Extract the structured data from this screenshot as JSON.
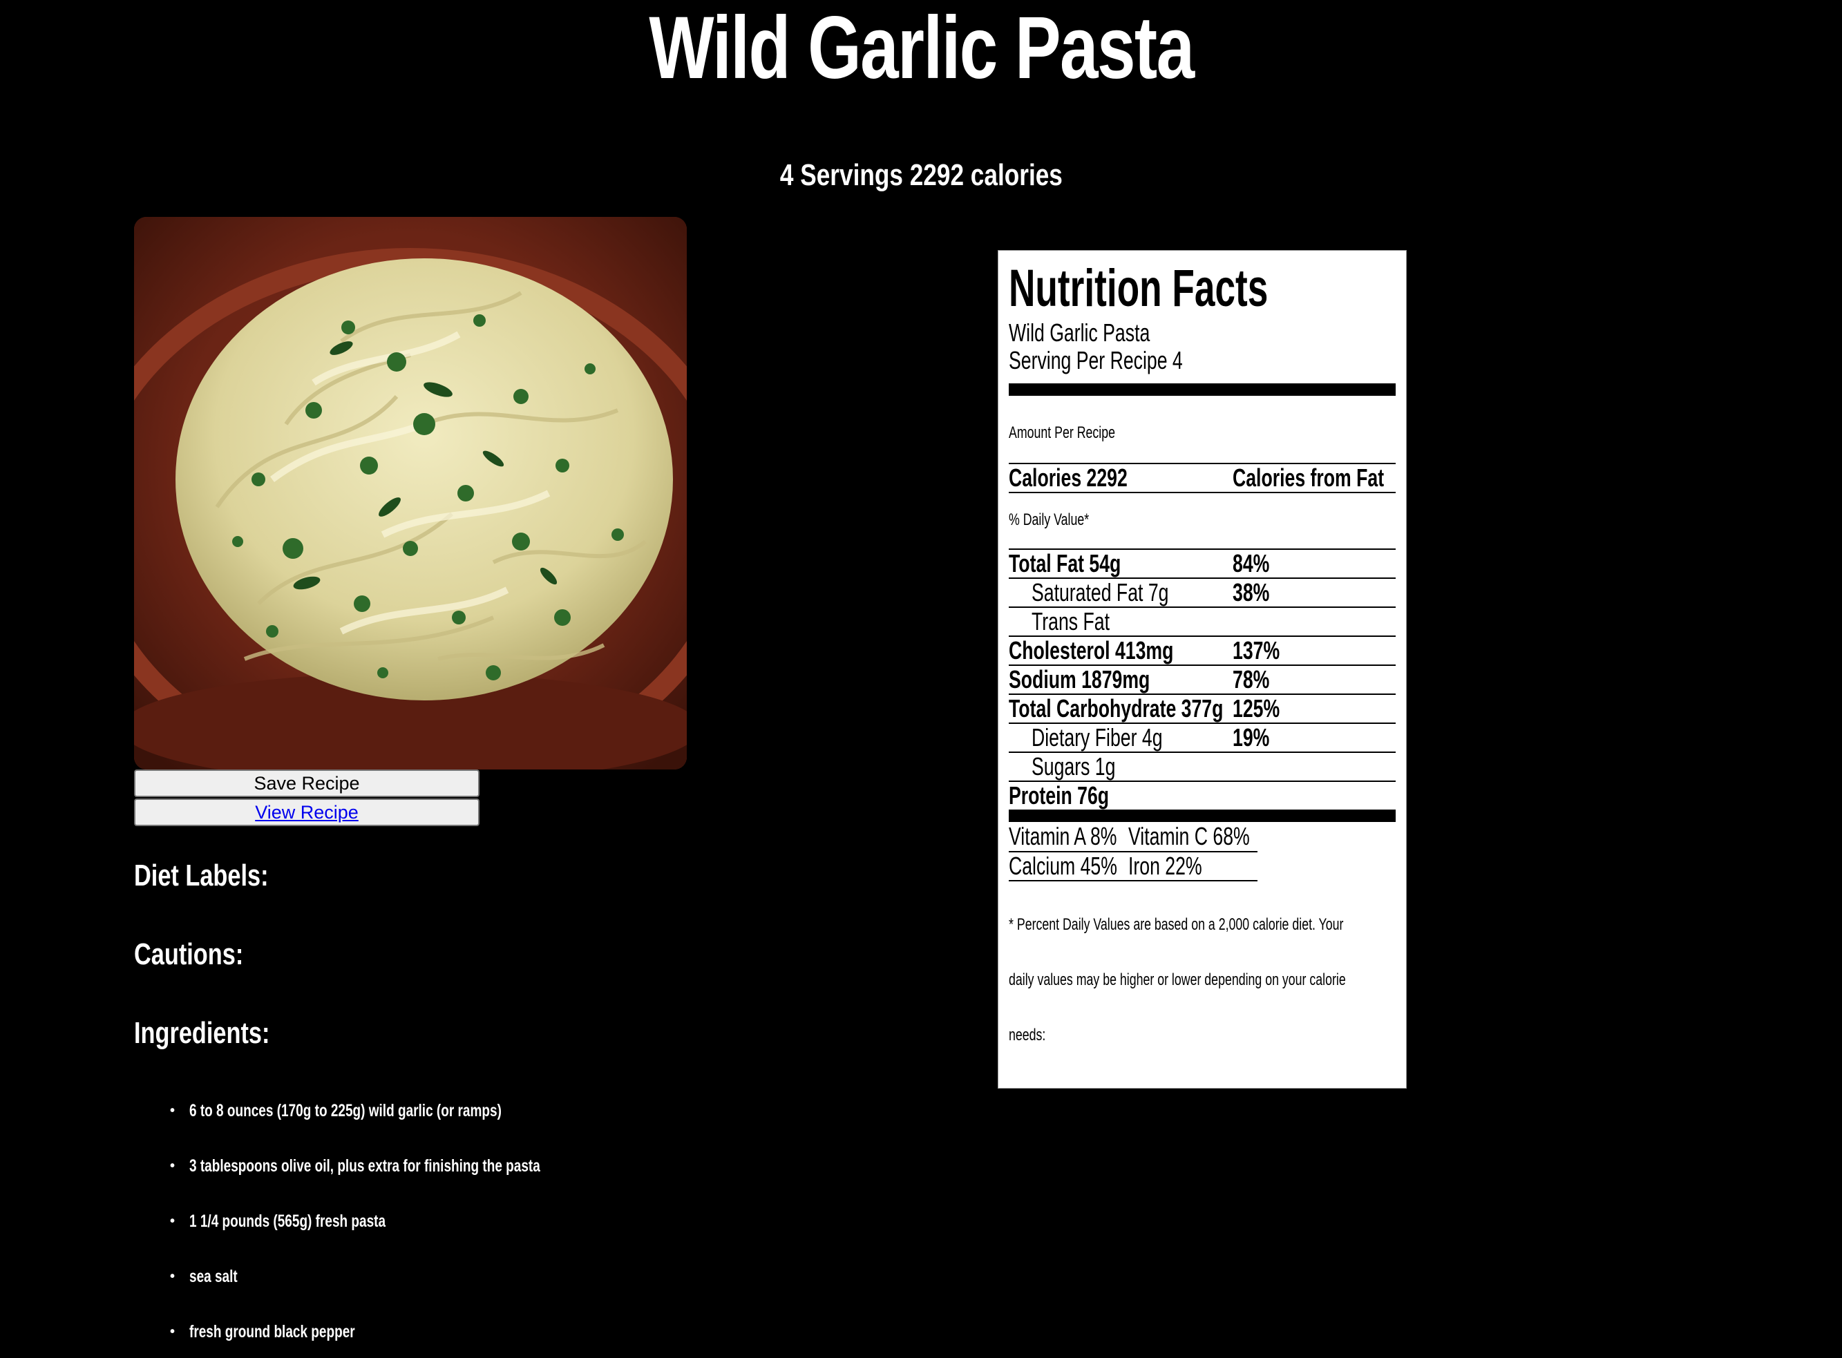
{
  "title": "Wild Garlic Pasta",
  "subtitle": "4 Servings 2292 calories",
  "image": {
    "alt": "Wild Garlic Pasta"
  },
  "buttons": {
    "save_label": "Save Recipe",
    "view_label": "View Recipe"
  },
  "sections": {
    "diet_labels": "Diet Labels:",
    "cautions": "Cautions:",
    "ingredients": "Ingredients:"
  },
  "ingredients": [
    "6 to 8 ounces (170g to 225g) wild garlic (or ramps)",
    "3 tablespoons olive oil, plus extra for finishing the pasta",
    "1 1/4 pounds (565g) fresh pasta",
    "sea salt",
    "fresh ground black pepper"
  ],
  "nutrition": {
    "heading": "Nutrition Facts",
    "recipe_name": "Wild Garlic Pasta",
    "servings": "Serving Per Recipe 4",
    "amount_per": "Amount Per Recipe",
    "calories": "Calories 2292",
    "calories_from_fat": "Calories from Fat",
    "daily_value": "% Daily Value*",
    "rows": [
      {
        "label": "Total Fat 54g",
        "percent": "84%",
        "indent": false
      },
      {
        "label": "Saturated Fat 7g",
        "percent": "38%",
        "indent": true
      },
      {
        "label": "Trans Fat",
        "percent": "",
        "indent": true
      },
      {
        "label": "Cholesterol 413mg",
        "percent": "137%",
        "indent": false
      },
      {
        "label": "Sodium 1879mg",
        "percent": "78%",
        "indent": false
      },
      {
        "label": "Total Carbohydrate 377g",
        "percent": "125%",
        "indent": false
      },
      {
        "label": "Dietary Fiber 4g",
        "percent": "19%",
        "indent": true
      },
      {
        "label": "Sugars 1g",
        "percent": "",
        "indent": true
      },
      {
        "label": "Protein 76g",
        "percent": "",
        "indent": false
      }
    ],
    "vitamins": [
      {
        "a": "Vitamin A 8%",
        "b": "Vitamin C 68%"
      },
      {
        "a": "Calcium 45%",
        "b": "Iron 22%"
      }
    ],
    "footnote": [
      "* Percent Daily Values are based on a 2,000 calorie diet. Your",
      "daily values may be higher or lower depending on your calorie",
      "needs:"
    ]
  },
  "colors": {
    "page_background": "#000000",
    "label_background": "#ffffff",
    "link": "#0000ee",
    "button_background": "#efefef"
  }
}
